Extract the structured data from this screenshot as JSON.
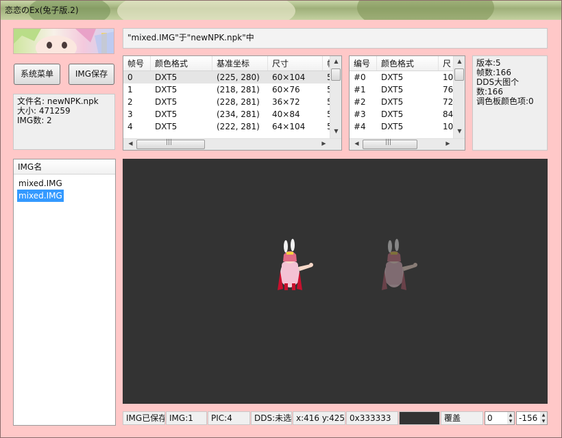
{
  "window": {
    "title": "恋恋のEx(兔子版.2)"
  },
  "path_bar": {
    "text": "\"mixed.IMG\"于\"newNPK.npk\"中"
  },
  "buttons": {
    "system_menu": "系统菜单",
    "img_save": "IMG保存"
  },
  "file_info": {
    "name": "文件名: newNPK.npk",
    "size": "大小: 471259",
    "img_count": "IMG数: 2"
  },
  "frames_table": {
    "headers": [
      "帧号",
      "颜色格式",
      "基准坐标",
      "尺寸",
      "帧"
    ],
    "rows": [
      [
        "0",
        "DXT5",
        "(225, 280)",
        "60×104",
        "5"
      ],
      [
        "1",
        "DXT5",
        "(218, 281)",
        "60×76",
        "5"
      ],
      [
        "2",
        "DXT5",
        "(228, 281)",
        "36×72",
        "5"
      ],
      [
        "3",
        "DXT5",
        "(234, 281)",
        "40×84",
        "5"
      ],
      [
        "4",
        "DXT5",
        "(222, 281)",
        "64×104",
        "5"
      ]
    ]
  },
  "dds_table": {
    "headers": [
      "编号",
      "颜色格式",
      "尺"
    ],
    "rows": [
      [
        "#0",
        "DXT5",
        "10"
      ],
      [
        "#1",
        "DXT5",
        "76"
      ],
      [
        "#2",
        "DXT5",
        "72"
      ],
      [
        "#3",
        "DXT5",
        "84"
      ],
      [
        "#4",
        "DXT5",
        "10"
      ]
    ]
  },
  "img_info": {
    "version": "版本:5",
    "frames": "帧数:166",
    "dds_count": "DDS大图个数:166",
    "palette": "调色板颜色项:0"
  },
  "img_list": {
    "header": "IMG名",
    "items": [
      "mixed.IMG",
      "mixed.IMG"
    ],
    "selected_index": 1
  },
  "status_bar": {
    "saved": "IMG已保存",
    "img": "IMG:1",
    "pic": "PIC:4",
    "dds": "DDS:未选",
    "coords": "x:416 y:425",
    "color_hex": "0x333333",
    "color_swatch": "#333333",
    "mode": "覆盖",
    "offset_x": "0",
    "offset_y": "-156"
  },
  "colors": {
    "window_bg": "#ffc8c8",
    "canvas_bg": "#333333",
    "selection": "#3399ff"
  },
  "icons": {
    "scroll_up": "scroll-up-arrow-icon",
    "scroll_down": "scroll-down-arrow-icon",
    "scroll_left": "scroll-left-arrow-icon",
    "scroll_right": "scroll-right-arrow-icon"
  }
}
